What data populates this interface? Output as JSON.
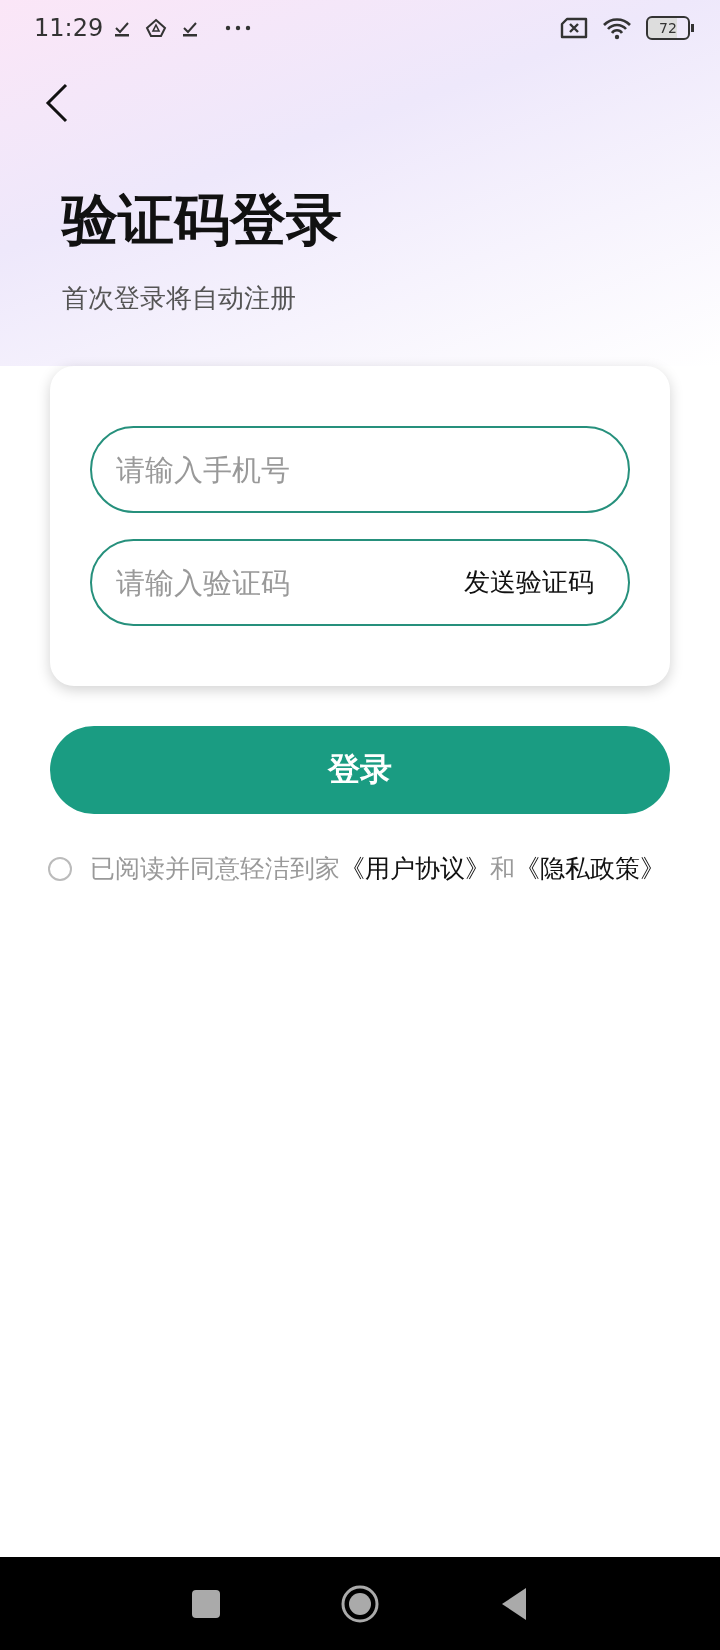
{
  "status_bar": {
    "time": "11:29",
    "battery": "72"
  },
  "title": "验证码登录",
  "subtitle": "首次登录将自动注册",
  "form": {
    "phone": {
      "placeholder": "请输入手机号"
    },
    "code": {
      "placeholder": "请输入验证码",
      "send_button": "发送验证码"
    }
  },
  "login_button": "登录",
  "agreement": {
    "checked": false,
    "parts": [
      {
        "kind": "text",
        "text": "已阅读并同意轻洁到家"
      },
      {
        "kind": "link",
        "text": "《用户协议》"
      },
      {
        "kind": "text",
        "text": "和"
      },
      {
        "kind": "link",
        "text": "《隐私政策》"
      }
    ]
  }
}
